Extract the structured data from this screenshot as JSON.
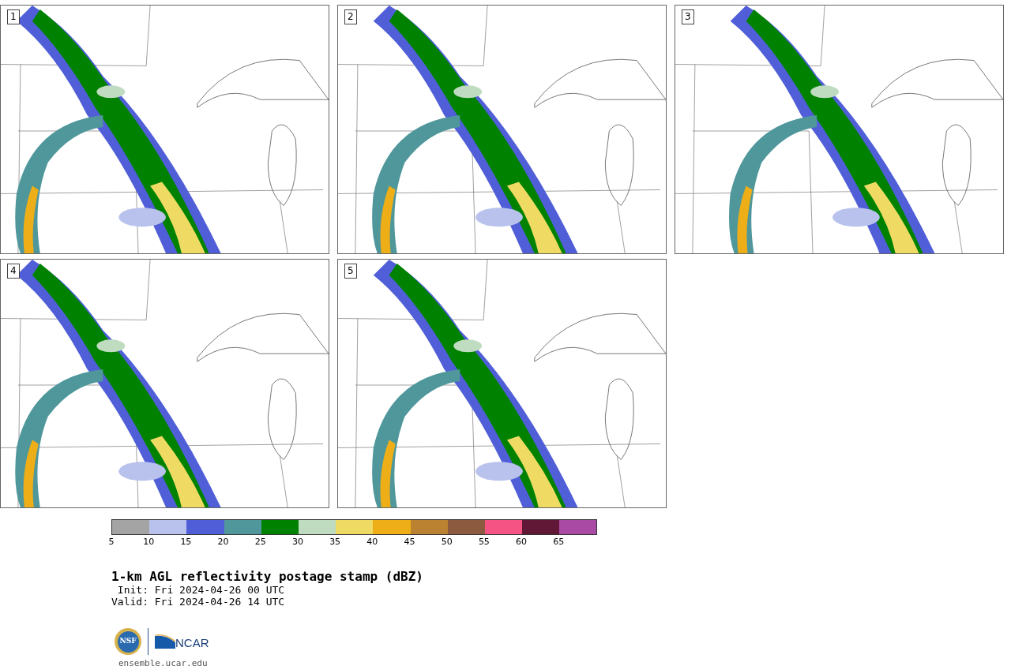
{
  "panels": [
    {
      "label": "1"
    },
    {
      "label": "2"
    },
    {
      "label": "3"
    },
    {
      "label": "4"
    },
    {
      "label": "5"
    }
  ],
  "colorbar": {
    "bins": [
      {
        "color": "#a4a4a4"
      },
      {
        "color": "#b8c2ed"
      },
      {
        "color": "#505fd8"
      },
      {
        "color": "#4f979b"
      },
      {
        "color": "#008200"
      },
      {
        "color": "#c0dcc0"
      },
      {
        "color": "#efdb63"
      },
      {
        "color": "#eeae17"
      },
      {
        "color": "#bb8232"
      },
      {
        "color": "#8b5a3f"
      },
      {
        "color": "#f55383"
      },
      {
        "color": "#611836"
      },
      {
        "color": "#a94aa4"
      }
    ],
    "ticks": [
      "5",
      "10",
      "15",
      "20",
      "25",
      "30",
      "35",
      "40",
      "45",
      "50",
      "55",
      "60",
      "65"
    ]
  },
  "title": "1-km AGL reflectivity postage stamp (dBZ)",
  "init": " Init: Fri 2024-04-26 00 UTC",
  "valid": "Valid: Fri 2024-04-26 14 UTC",
  "logo": {
    "left": "NSF",
    "right": "NCAR"
  },
  "url": "ensemble.ucar.edu"
}
